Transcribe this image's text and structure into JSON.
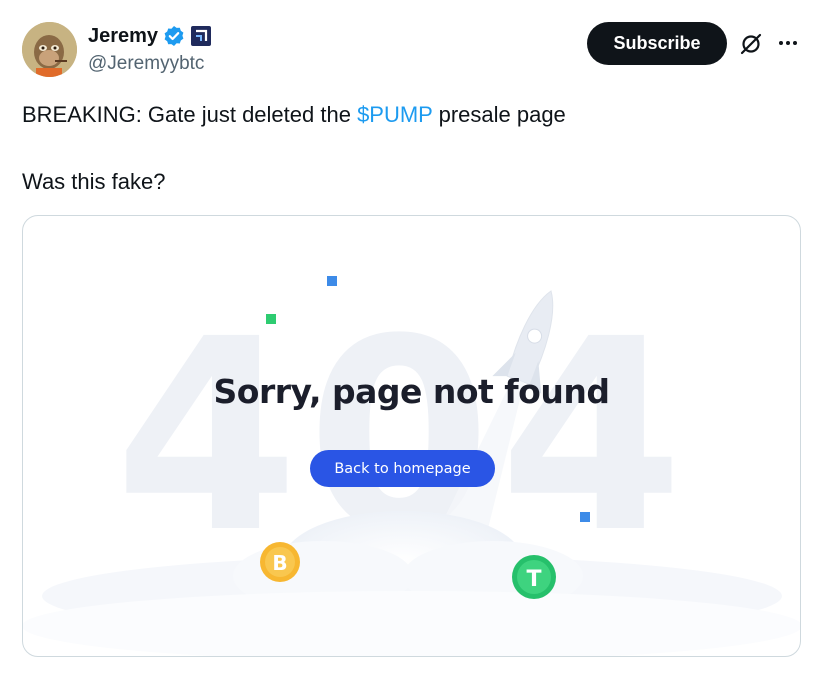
{
  "author": {
    "display_name": "Jeremy",
    "handle": "@Jeremyybtc",
    "avatar_icon": "bored-ape-avatar",
    "verified_icon": "verified-badge-icon",
    "affiliate_icon": "affiliate-badge-icon"
  },
  "actions": {
    "subscribe_label": "Subscribe",
    "grok_icon": "grok-icon",
    "more_icon": "more-icon"
  },
  "tweet": {
    "text_before": "BREAKING: Gate just deleted the ",
    "cashtag": "$PUMP",
    "text_after": " presale page",
    "line2": "Was this fake?"
  },
  "media": {
    "background_text": "404",
    "title": "Sorry, page not found",
    "button_label": "Back to homepage",
    "coin_1": "B",
    "coin_2": "T"
  },
  "colors": {
    "link": "#1d9bf0",
    "button_dark": "#0f1419",
    "home_button": "#2a55e5"
  }
}
